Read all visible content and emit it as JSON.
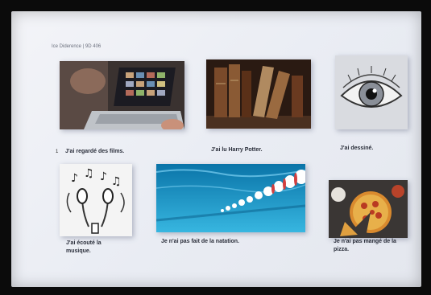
{
  "slide": {
    "header": "Ice Diderence | 9D 406",
    "bullet": "1",
    "items": [
      {
        "caption": "J'ai regardé des films."
      },
      {
        "caption": "J'ai lu Harry Potter."
      },
      {
        "caption": "J'ai dessiné."
      },
      {
        "caption": "J'ai écouté la musique."
      },
      {
        "caption": "Je n'ai pas fait de la natation."
      },
      {
        "caption": "Je n'ai pas mangé de la pizza."
      }
    ]
  },
  "colors": {
    "screen_bg": "#eef0f5",
    "caption_text": "#2a2e3a"
  },
  "icons": [
    "laptop-icon",
    "books-icon",
    "eye-icon",
    "headphones-icon",
    "pool-icon",
    "pizza-icon"
  ]
}
